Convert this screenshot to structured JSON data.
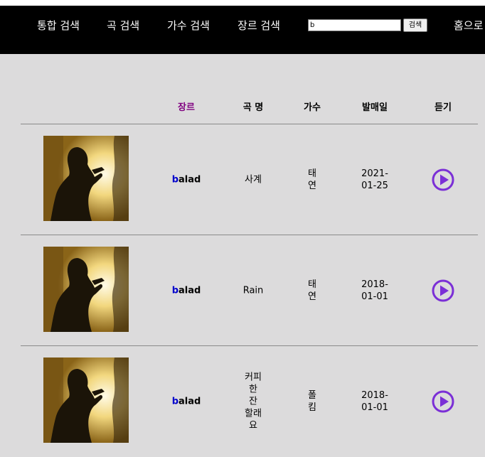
{
  "nav": {
    "items": [
      "통합 검색",
      "곡 검색",
      "가수 검색",
      "장르 검색"
    ],
    "home": "홈으로",
    "search_value": "b",
    "search_button": "검색"
  },
  "table": {
    "headers": {
      "genre": "장르",
      "title": "곡 명",
      "singer": "가수",
      "release": "발매일",
      "listen": "듣기"
    },
    "rows": [
      {
        "genre_first": "b",
        "genre_rest": "alad",
        "title": "사계",
        "singer": "태연",
        "release": "2021-01-25"
      },
      {
        "genre_first": "b",
        "genre_rest": "alad",
        "title": "Rain",
        "singer": "태연",
        "release": "2018-01-01"
      },
      {
        "genre_first": "b",
        "genre_rest": "alad",
        "title": "커피 한 잔 할래요",
        "singer": "폴킴",
        "release": "2018-01-01"
      }
    ]
  },
  "colors": {
    "nav_bg": "#000000",
    "page_bg": "#dcdbdc",
    "genre_header": "#800080",
    "highlight": "#0000cc",
    "play_icon": "#7b2fd6"
  },
  "icons": {
    "play": "play-circle-icon",
    "cover": "singer-silhouette-image"
  }
}
